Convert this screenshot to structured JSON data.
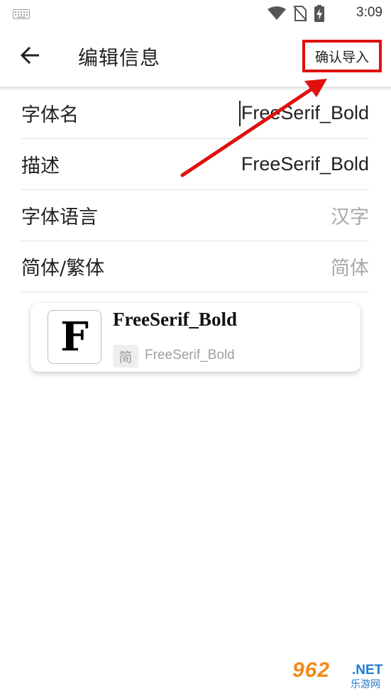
{
  "status_bar": {
    "time": "3:09",
    "icons": [
      "keyboard-icon",
      "wifi-icon",
      "no-sim-icon",
      "battery-charging-icon"
    ]
  },
  "toolbar": {
    "title": "编辑信息",
    "confirm_label": "确认导入",
    "back_icon": "arrow-left-icon"
  },
  "form": {
    "rows": [
      {
        "label": "字体名",
        "value": "FreeSerif_Bold"
      },
      {
        "label": "描述",
        "value": "FreeSerif_Bold"
      },
      {
        "label": "字体语言",
        "value": "汉字"
      },
      {
        "label": "简体/繁体",
        "value": "简体"
      }
    ]
  },
  "preview": {
    "thumb_letter": "F",
    "title": "FreeSerif_Bold",
    "tag": "简",
    "subtitle": "FreeSerif_Bold"
  },
  "annotation": {
    "highlight_color": "#e01010"
  },
  "watermark": {
    "main": "962",
    "net": ".NET",
    "sub": "乐游网"
  }
}
